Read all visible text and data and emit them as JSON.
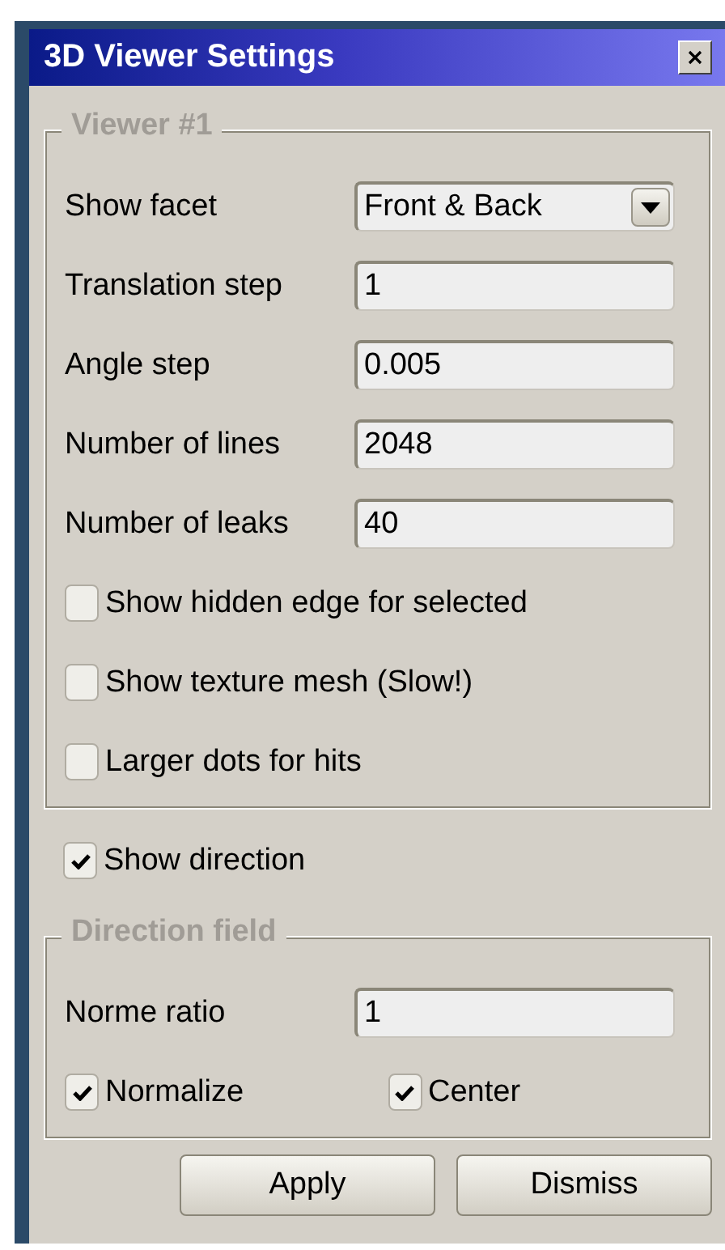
{
  "window": {
    "title": "3D Viewer Settings"
  },
  "viewer_group": {
    "title": "Viewer #1",
    "fields": [
      {
        "kind": "dropdown",
        "label": "Show facet",
        "value": "Front & Back"
      },
      {
        "kind": "text",
        "label": "Translation step",
        "value": "1"
      },
      {
        "kind": "text",
        "label": "Angle step",
        "value": "0.005"
      },
      {
        "kind": "text",
        "label": "Number of lines",
        "value": "2048"
      },
      {
        "kind": "text",
        "label": "Number of leaks",
        "value": "40"
      }
    ],
    "checkboxes": [
      {
        "label": "Show hidden edge for selected",
        "checked": false
      },
      {
        "label": "Show texture mesh (Slow!)",
        "checked": false
      },
      {
        "label": "Larger dots for hits",
        "checked": false
      }
    ]
  },
  "show_direction": {
    "label": "Show direction",
    "checked": true
  },
  "direction_group": {
    "title": "Direction field",
    "fields": [
      {
        "kind": "text",
        "label": "Norme ratio",
        "value": "1"
      }
    ],
    "checkboxes": [
      {
        "label": "Normalize",
        "checked": true
      },
      {
        "label": "Center",
        "checked": true
      }
    ]
  },
  "buttons": [
    "Apply",
    "Dismiss"
  ]
}
